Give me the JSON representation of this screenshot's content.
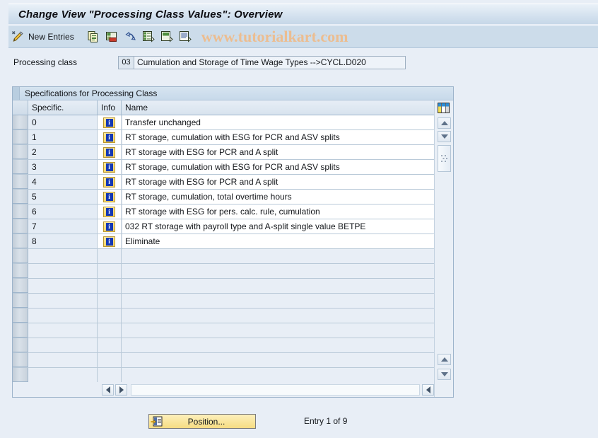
{
  "window": {
    "title": "Change View \"Processing Class Values\": Overview"
  },
  "toolbar": {
    "new_entries_label": "New Entries",
    "icons": [
      {
        "name": "pencil-icon"
      },
      {
        "name": "copy-icon"
      },
      {
        "name": "delete-row-icon"
      },
      {
        "name": "undo-icon"
      },
      {
        "name": "select-all-icon"
      },
      {
        "name": "deselect-all-icon"
      },
      {
        "name": "details-icon"
      }
    ],
    "watermark": "www.tutorialkart.com"
  },
  "header_field": {
    "label": "Processing class",
    "key": "03",
    "text": "Cumulation and Storage of Time Wage Types -->CYCL.D020"
  },
  "panel": {
    "title": "Specifications for Processing Class",
    "columns": [
      "Specific.",
      "Info",
      "Name"
    ],
    "rows": [
      {
        "specific": "0",
        "info": "i",
        "name": "Transfer unchanged"
      },
      {
        "specific": "1",
        "info": "i",
        "name": "RT storage, cumulation with ESG for PCR and ASV splits"
      },
      {
        "specific": "2",
        "info": "i",
        "name": "RT storage with ESG for PCR and A split"
      },
      {
        "specific": "3",
        "info": "i",
        "name": "RT storage, cumulation with ESG for PCR and ASV splits"
      },
      {
        "specific": "4",
        "info": "i",
        "name": "RT storage with ESG for PCR and A split"
      },
      {
        "specific": "5",
        "info": "i",
        "name": "RT storage, cumulation, total overtime hours"
      },
      {
        "specific": "6",
        "info": "i",
        "name": "RT storage with ESG for pers. calc. rule, cumulation"
      },
      {
        "specific": "7",
        "info": "i",
        "name": "032 RT storage with payroll type and A-split single value BETPE"
      },
      {
        "specific": "8",
        "info": "i",
        "name": "Eliminate"
      }
    ],
    "empty_row_count": 9
  },
  "footer": {
    "position_button": "Position...",
    "entry_status": "Entry 1 of 9"
  },
  "colors": {
    "window_background": "#e8eef6",
    "titlebar": "#d5e2ef",
    "toolbar": "#ccdcea",
    "watermark": "#ecbd90",
    "button_accent": "#f6dc83",
    "info_icon_border": "#b9962f",
    "info_icon_glyph": "#1438b4"
  }
}
